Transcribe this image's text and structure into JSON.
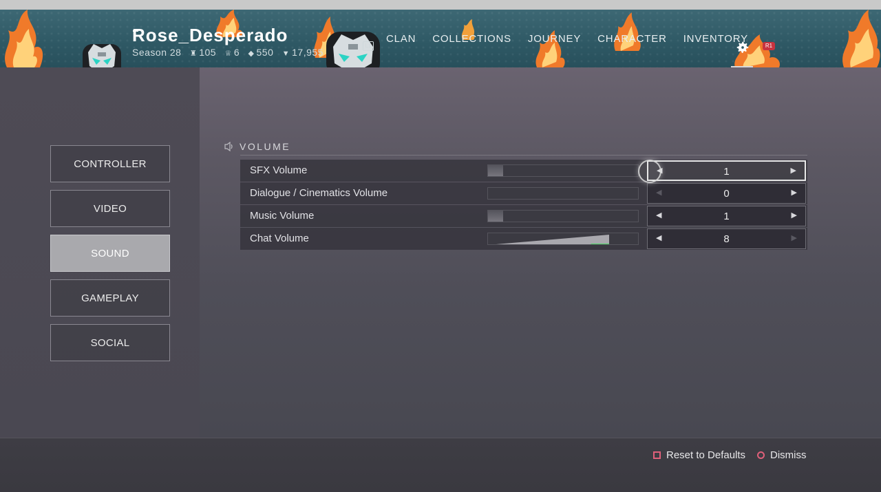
{
  "header": {
    "player_name": "Rose_Desperado",
    "season": "Season 28",
    "stats": [
      {
        "icon": "trophy-icon",
        "value": "105"
      },
      {
        "icon": "chalice-icon",
        "value": "6"
      },
      {
        "icon": "diamond-icon",
        "value": "550"
      },
      {
        "icon": "guardian-rank-icon",
        "value": "17,955"
      }
    ],
    "nav_hint_left": "L1",
    "nav_hint_right": "R1",
    "nav": [
      "CLAN",
      "COLLECTIONS",
      "JOURNEY",
      "CHARACTER",
      "INVENTORY"
    ]
  },
  "sidebar": {
    "items": [
      {
        "label": "CONTROLLER",
        "active": false
      },
      {
        "label": "VIDEO",
        "active": false
      },
      {
        "label": "SOUND",
        "active": true
      },
      {
        "label": "GAMEPLAY",
        "active": false
      },
      {
        "label": "SOCIAL",
        "active": false
      }
    ]
  },
  "volume": {
    "title": "VOLUME",
    "rows": [
      {
        "label": "SFX Volume",
        "value": "1",
        "level": 0.1,
        "focused": true
      },
      {
        "label": "Dialogue / Cinematics Volume",
        "value": "0",
        "level": 0.0,
        "focused": false
      },
      {
        "label": "Music Volume",
        "value": "1",
        "level": 0.1,
        "focused": false
      },
      {
        "label": "Chat Volume",
        "value": "8",
        "level": 0.8,
        "focused": false
      }
    ]
  },
  "footer": {
    "reset_label": "Reset to Defaults",
    "dismiss_label": "Dismiss"
  },
  "colors": {
    "accent_pink": "#e0607a",
    "chat_bar_green": "#4cd964",
    "active_tab": "#a9a9ad"
  }
}
